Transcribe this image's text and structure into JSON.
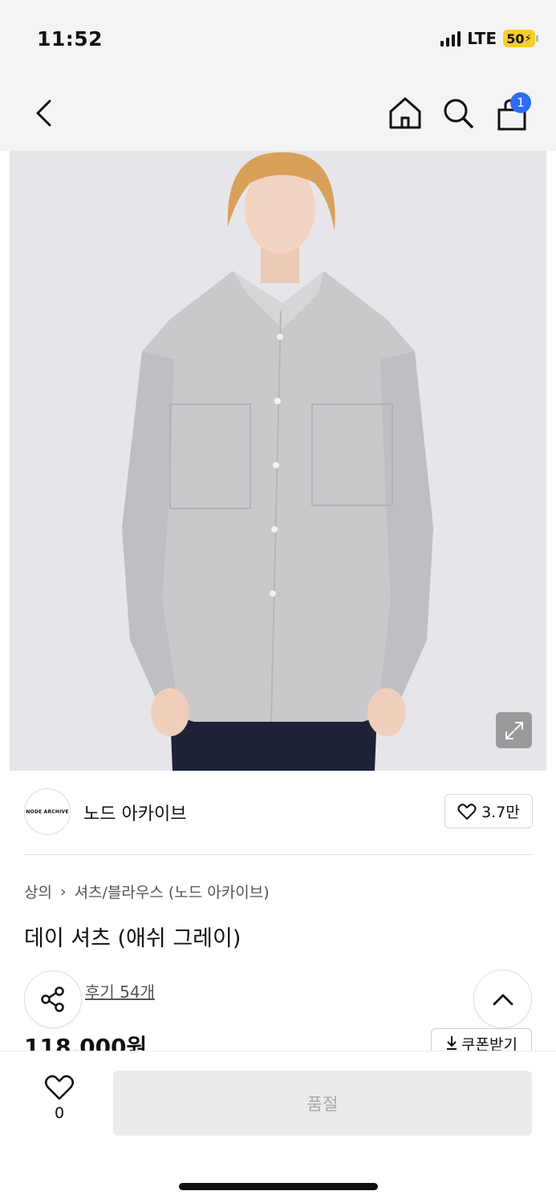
{
  "status_bar": {
    "time": "11:52",
    "network": "LTE",
    "battery": "50"
  },
  "header": {
    "cart_count": "1"
  },
  "brand": {
    "logo_text": "NODE ARCHIVE",
    "name": "노드 아카이브",
    "like_count": "3.7만"
  },
  "breadcrumb": {
    "category": "상의",
    "separator": "›",
    "subcategory": "셔츠/블라우스 (노드 아카이브)"
  },
  "product": {
    "title": "데이 셔츠 (애쉬 그레이)",
    "review_link": "후기 54개",
    "price": "118,000원",
    "coupon_label": "쿠폰받기"
  },
  "bottom_bar": {
    "wish_count": "0",
    "buy_label": "품절"
  },
  "colors": {
    "badge": "#2d6cf5",
    "battery": "#f6cf2a",
    "soldout_bg": "#ebebeb"
  },
  "icons": [
    "back-arrow-icon",
    "home-icon",
    "search-icon",
    "shopping-bag-icon",
    "expand-icon",
    "heart-icon",
    "share-icon",
    "chevron-up-icon",
    "download-icon"
  ]
}
